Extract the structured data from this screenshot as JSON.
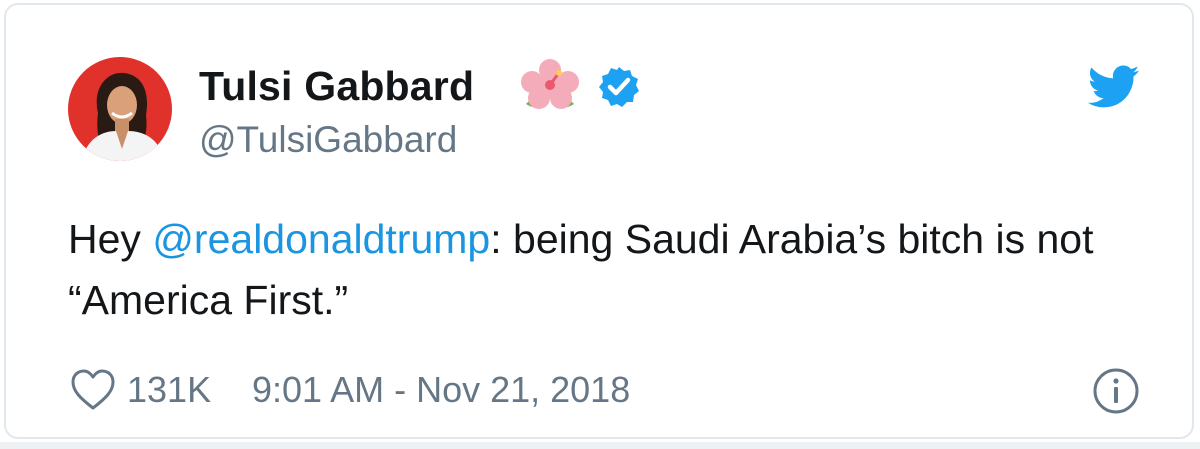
{
  "tweet": {
    "author_name": "Tulsi Gabbard",
    "author_handle": "@TulsiGabbard",
    "name_emoji": "hibiscus-icon",
    "verified": true,
    "text_before_mention": "Hey ",
    "mention": "@realdonaldtrump",
    "text_after_mention": ": being Saudi Arabia’s bitch is not “America First.”",
    "like_count": "131K",
    "timestamp": "9:01 AM - Nov 21, 2018"
  },
  "colors": {
    "text": "#14171a",
    "secondary": "#657786",
    "link": "#1b95e0",
    "avatar_background": "#e0312b",
    "border": "#e1e8ed"
  },
  "icons": [
    "twitter-bird-icon",
    "verified-badge-icon",
    "hibiscus-icon",
    "heart-icon",
    "info-icon"
  ]
}
